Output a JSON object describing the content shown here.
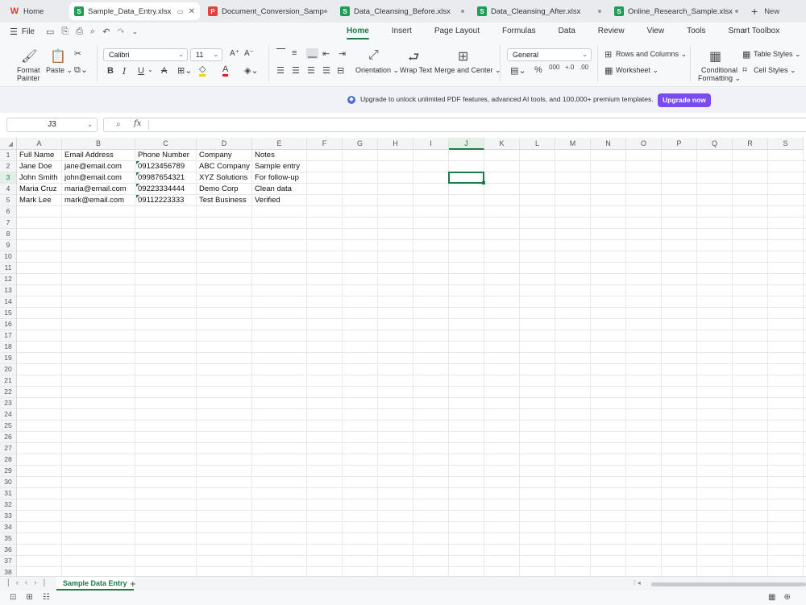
{
  "tabs": [
    {
      "label": "Home",
      "type": "home",
      "icon": "wps-logo-icon",
      "color": "#e8322a",
      "glyph": "W",
      "active": false
    },
    {
      "label": "Sample_Data_Entry.xlsx",
      "type": "sheet",
      "icon": "sheet-icon",
      "color": "#1f9d55",
      "glyph": "S",
      "active": true
    },
    {
      "label": "Document_Conversion_Sample.pdf",
      "type": "pdf",
      "icon": "pdf-icon",
      "color": "#e0413a",
      "glyph": "P",
      "active": false
    },
    {
      "label": "Data_Cleansing_Before.xlsx",
      "type": "sheet",
      "icon": "sheet-icon",
      "color": "#1f9d55",
      "glyph": "S",
      "active": false
    },
    {
      "label": "Data_Cleansing_After.xlsx",
      "type": "sheet",
      "icon": "sheet-icon",
      "color": "#1f9d55",
      "glyph": "S",
      "active": false
    },
    {
      "label": "Online_Research_Sample.xlsx",
      "type": "sheet",
      "icon": "sheet-icon",
      "color": "#1f9d55",
      "glyph": "S",
      "active": false
    }
  ],
  "new_tab_label": "New",
  "file_menu": "File",
  "menu_tabs": [
    "Home",
    "Insert",
    "Page Layout",
    "Formulas",
    "Data",
    "Review",
    "View",
    "Tools",
    "Smart Toolbox"
  ],
  "active_menu": "Home",
  "ribbon": {
    "format_painter": "Format Painter",
    "format_painter_l1": "Format",
    "format_painter_l2": "Painter",
    "paste": "Paste",
    "font_name": "Calibri",
    "font_size": "11",
    "orientation": "Orientation",
    "wrap_text": "Wrap Text",
    "merge_center": "Merge and Center",
    "number_format": "General",
    "rows_columns": "Rows and Columns",
    "worksheet": "Worksheet",
    "conditional_l1": "Conditional",
    "conditional_l2": "Formatting",
    "table_styles": "Table Styles",
    "cell_styles": "Cell Styles"
  },
  "banner": {
    "text": "Upgrade to unlock unlimited PDF features, advanced AI tools, and 100,000+ premium templates.",
    "button": "Upgrade now"
  },
  "name_box": "J3",
  "formula": "",
  "columns": [
    "A",
    "B",
    "C",
    "D",
    "E",
    "F",
    "G",
    "H",
    "I",
    "J",
    "K",
    "L",
    "M",
    "N",
    "O",
    "P",
    "Q",
    "R",
    "S"
  ],
  "selected_column": "J",
  "selected_cell": "J3",
  "row_count": 38,
  "cells": [
    [
      "Full Name",
      "Email Address",
      "Phone Number",
      "Company",
      "Notes"
    ],
    [
      "Jane Doe",
      "jane@email.com",
      "09123456789",
      "ABC Company",
      "Sample entry"
    ],
    [
      "John Smith",
      "john@email.com",
      "09987654321",
      "XYZ Solutions",
      "For follow-up"
    ],
    [
      "Maria Cruz",
      "maria@email.com",
      "09223334444",
      "Demo Corp",
      "Clean data"
    ],
    [
      "Mark Lee",
      "mark@email.com",
      "09112223333",
      "Test Business",
      "Verified"
    ]
  ],
  "sheet_tabs": [
    "Sample Data Entry"
  ],
  "accent_color": "#1c7a47"
}
